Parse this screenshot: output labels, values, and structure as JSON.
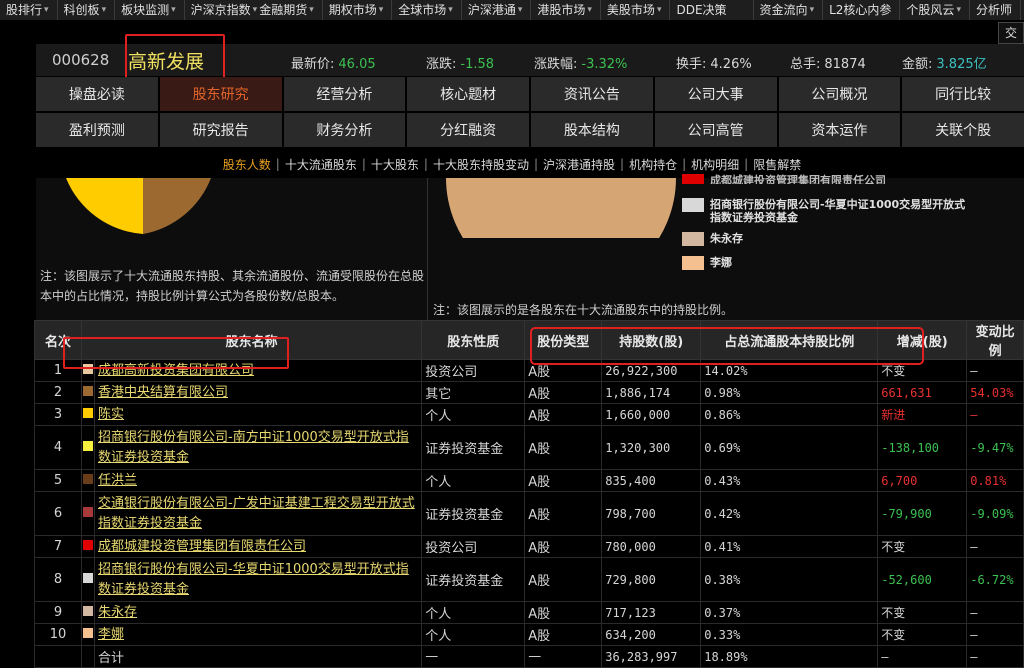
{
  "topbar": {
    "items": [
      "股排行",
      "科创板",
      "板块监测",
      "沪深京指数",
      "金融期货",
      "期权市场",
      "全球市场",
      "沪深港通",
      "港股市场",
      "美股市场",
      "DDE决策",
      "资金流向",
      "L2核心内参",
      "个股风云",
      "分析师"
    ],
    "search_value": "交"
  },
  "stock": {
    "code": "000628",
    "name": "高新发展",
    "latest_label": "最新价:",
    "latest": "46.05",
    "change_label": "涨跌:",
    "change": "-1.58",
    "pct_label": "涨跌幅:",
    "pct": "-3.32%",
    "turnover_label": "换手:",
    "turnover": "4.26%",
    "volume_label": "总手:",
    "volume": "81874",
    "amount_label": "金额:",
    "amount": "3.825亿"
  },
  "nav": {
    "row1": [
      "操盘必读",
      "股东研究",
      "经营分析",
      "核心题材",
      "资讯公告",
      "公司大事",
      "公司概况",
      "同行比较"
    ],
    "row2": [
      "盈利预测",
      "研究报告",
      "财务分析",
      "分红融资",
      "股本结构",
      "公司高管",
      "资本运作",
      "关联个股"
    ],
    "active": "股东研究"
  },
  "subnav": {
    "items": [
      "股东人数",
      "十大流通股东",
      "十大股东",
      "十大股东持股变动",
      "沪深港通持股",
      "机构持仓",
      "机构明细",
      "限售解禁"
    ],
    "active": "股东人数"
  },
  "charts": {
    "note_left": "注：该图展示了十大流通股东持股、其余流通股份、流通受限股份在总股本中的占比情况，持股比例计算公式为各股份数/总股本。",
    "note_right": "注：该图展示的是各股东在十大流通股东中的持股比例。",
    "legend": [
      {
        "label": "成都城建投资管理集团有限责任公司",
        "color": "#e00000"
      },
      {
        "label": "招商银行股份有限公司-华夏中证1000交易型开放式指数证券投资基金",
        "color": "#d8d8d8"
      },
      {
        "label": "朱永存",
        "color": "#d2b8a0"
      },
      {
        "label": "李娜",
        "color": "#f5c090"
      }
    ],
    "pie_colors": {
      "left_a": "#ffcc00",
      "left_b": "#9c6a30",
      "right": "#d6a574"
    }
  },
  "table": {
    "headers": [
      "名次",
      "股东名称",
      "股东性质",
      "股份类型",
      "持股数(股)",
      "占总流通股本持股比例",
      "增减(股)",
      "变动比例"
    ],
    "rows": [
      {
        "rank": "1",
        "color": "#e8c8a0",
        "name": "成都高新投资集团有限公司",
        "nature": "投资公司",
        "type": "A股",
        "shares": "26,922,300",
        "ratio": "14.02%",
        "change": "不变",
        "change_cls": "",
        "pct": "—",
        "pct_cls": ""
      },
      {
        "rank": "2",
        "color": "#9c6a30",
        "name": "香港中央结算有限公司",
        "nature": "其它",
        "type": "A股",
        "shares": "1,886,174",
        "ratio": "0.98%",
        "change": "661,631",
        "change_cls": "r",
        "pct": "54.03%",
        "pct_cls": "r"
      },
      {
        "rank": "3",
        "color": "#ffcc00",
        "name": "陈实",
        "nature": "个人",
        "type": "A股",
        "shares": "1,660,000",
        "ratio": "0.86%",
        "change": "新进",
        "change_cls": "r",
        "pct": "—",
        "pct_cls": "r"
      },
      {
        "rank": "4",
        "color": "#f5f040",
        "name": "招商银行股份有限公司-南方中证1000交易型开放式指数证券投资基金",
        "nature": "证券投资基金",
        "type": "A股",
        "shares": "1,320,300",
        "ratio": "0.69%",
        "change": "-138,100",
        "change_cls": "g",
        "pct": "-9.47%",
        "pct_cls": "g"
      },
      {
        "rank": "5",
        "color": "#6a3c18",
        "name": "任洪兰",
        "nature": "个人",
        "type": "A股",
        "shares": "835,400",
        "ratio": "0.43%",
        "change": "6,700",
        "change_cls": "r",
        "pct": "0.81%",
        "pct_cls": "r"
      },
      {
        "rank": "6",
        "color": "#a83a3a",
        "name": "交通银行股份有限公司-广发中证基建工程交易型开放式指数证券投资基金",
        "nature": "证券投资基金",
        "type": "A股",
        "shares": "798,700",
        "ratio": "0.42%",
        "change": "-79,900",
        "change_cls": "g",
        "pct": "-9.09%",
        "pct_cls": "g"
      },
      {
        "rank": "7",
        "color": "#e00000",
        "name": "成都城建投资管理集团有限责任公司",
        "nature": "投资公司",
        "type": "A股",
        "shares": "780,000",
        "ratio": "0.41%",
        "change": "不变",
        "change_cls": "",
        "pct": "—",
        "pct_cls": ""
      },
      {
        "rank": "8",
        "color": "#d8d8d8",
        "name": "招商银行股份有限公司-华夏中证1000交易型开放式指数证券投资基金",
        "nature": "证券投资基金",
        "type": "A股",
        "shares": "729,800",
        "ratio": "0.38%",
        "change": "-52,600",
        "change_cls": "g",
        "pct": "-6.72%",
        "pct_cls": "g"
      },
      {
        "rank": "9",
        "color": "#d2b8a0",
        "name": "朱永存",
        "nature": "个人",
        "type": "A股",
        "shares": "717,123",
        "ratio": "0.37%",
        "change": "不变",
        "change_cls": "",
        "pct": "—",
        "pct_cls": ""
      },
      {
        "rank": "10",
        "color": "#f5c090",
        "name": "李娜",
        "nature": "个人",
        "type": "A股",
        "shares": "634,200",
        "ratio": "0.33%",
        "change": "不变",
        "change_cls": "",
        "pct": "—",
        "pct_cls": ""
      }
    ],
    "total": {
      "label": "合计",
      "nature": "—",
      "type": "—",
      "shares": "36,283,997",
      "ratio": "18.89%",
      "change": "—",
      "pct": "—"
    }
  }
}
